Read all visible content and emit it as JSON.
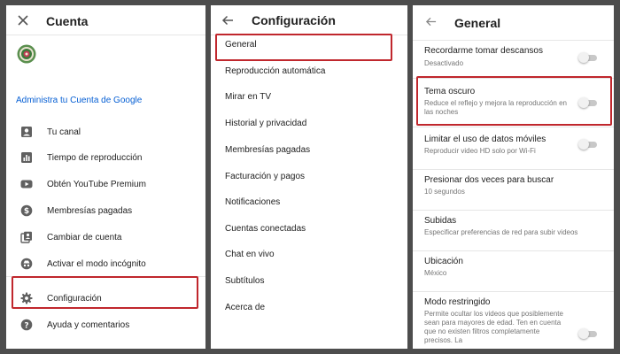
{
  "colors": {
    "accent_link": "#065fd4",
    "highlight": "#c0272d",
    "background": "#4d4d4d"
  },
  "panel1": {
    "close_icon": "close-icon",
    "title": "Cuenta",
    "google_link": "Administra tu Cuenta de Google",
    "items": [
      {
        "icon": "person-icon",
        "label": "Tu canal"
      },
      {
        "icon": "bar-chart-icon",
        "label": "Tiempo de reproducción"
      },
      {
        "icon": "youtube-icon",
        "label": "Obtén YouTube Premium"
      },
      {
        "icon": "dollar-icon",
        "label": "Membresías pagadas"
      },
      {
        "icon": "switch-account-icon",
        "label": "Cambiar de cuenta"
      },
      {
        "icon": "incognito-icon",
        "label": "Activar el modo incógnito"
      },
      {
        "icon": "gear-icon",
        "label": "Configuración"
      },
      {
        "icon": "help-icon",
        "label": "Ayuda y comentarios"
      }
    ]
  },
  "panel2": {
    "back_icon": "back-arrow-icon",
    "title": "Configuración",
    "items": [
      "General",
      "Reproducción automática",
      "Mirar en TV",
      "Historial y privacidad",
      "Membresías pagadas",
      "Facturación y pagos",
      "Notificaciones",
      "Cuentas conectadas",
      "Chat en vivo",
      "Subtítulos",
      "Acerca de"
    ]
  },
  "panel3": {
    "back_icon": "back-arrow-icon",
    "title": "General",
    "settings": [
      {
        "title": "Recordarme tomar descansos",
        "subtitle": "Desactivado",
        "toggle": true,
        "on": false
      },
      {
        "title": "Tema oscuro",
        "subtitle": "Reduce el reflejo y mejora la reproducción en las noches",
        "toggle": true,
        "on": false
      },
      {
        "title": "Limitar el uso de datos móviles",
        "subtitle": "Reproducir video HD solo por Wi-Fi",
        "toggle": true,
        "on": false
      },
      {
        "title": "Presionar dos veces para buscar",
        "subtitle": "10 segundos",
        "toggle": false
      },
      {
        "title": "Subidas",
        "subtitle": "Especificar preferencias de red para subir videos",
        "toggle": false
      },
      {
        "title": "Ubicación",
        "subtitle": "México",
        "toggle": false
      },
      {
        "title": "Modo restringido",
        "subtitle": "Permite ocultar los videos que posiblemente sean para mayores de edad. Ten en cuenta que no existen filtros completamente precisos. La",
        "toggle": true,
        "on": false
      }
    ]
  }
}
